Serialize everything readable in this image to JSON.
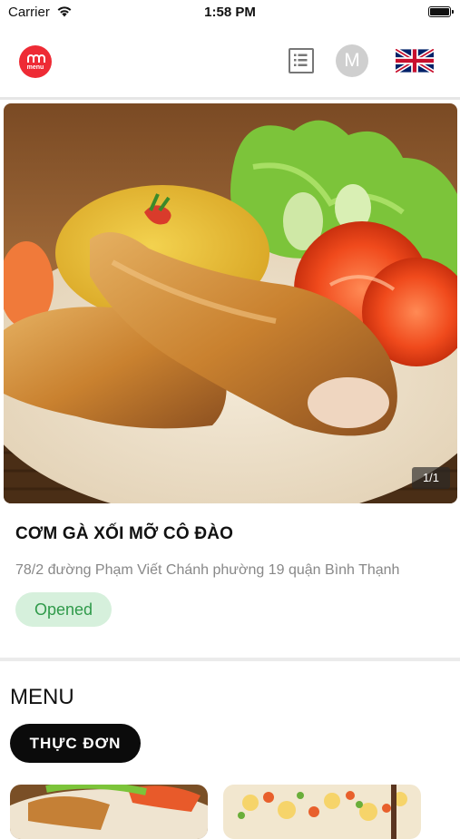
{
  "status_bar": {
    "carrier": "Carrier",
    "time": "1:58 PM"
  },
  "header": {
    "logo_text": "menu",
    "avatar_initial": "M",
    "icons": [
      "logo-icon",
      "menu-list-icon",
      "uk-flag-icon"
    ]
  },
  "hero": {
    "counter": "1/1"
  },
  "restaurant": {
    "name": "CƠM GÀ XỐI MỠ CÔ ĐÀO",
    "address": "78/2 đường Phạm Viết Chánh phường 19 quận Bình Thạnh",
    "status": "Opened"
  },
  "menu": {
    "heading": "MENU",
    "tab_label": "THỰC ĐƠN"
  },
  "colors": {
    "brand_red": "#ee2b35",
    "status_green_text": "#2f9a4a",
    "status_green_bg": "#d6f0dc",
    "tab_black": "#0b0b0b"
  }
}
